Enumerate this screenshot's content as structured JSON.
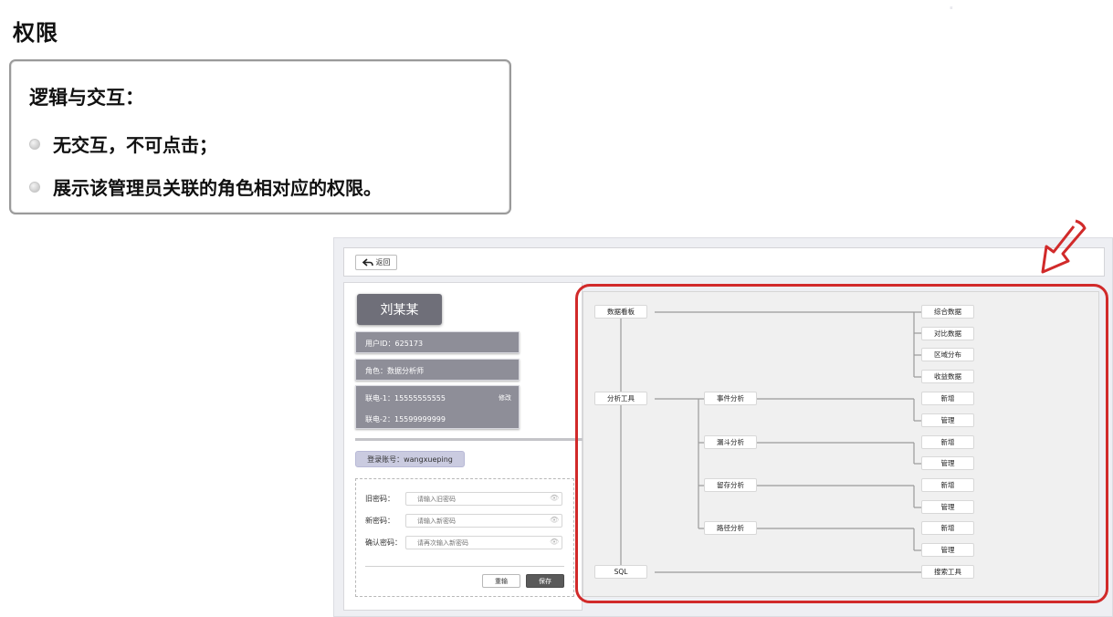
{
  "slide": {
    "title": "权限",
    "watermark": "   ·     ",
    "logic": {
      "heading": "逻辑与交互：",
      "bullets": [
        "无交互，不可点击；",
        "展示该管理员关联的角色相对应的权限。"
      ]
    }
  },
  "mockup": {
    "back_label": "返回",
    "user_name": "刘某某",
    "user_id": "用户ID：625173",
    "role": "角色：数据分析师",
    "phone1": "联电-1：15555555555",
    "phone2": "联电-2：15599999999",
    "edit_label": "修改",
    "account": "登录账号：wangxueping",
    "password_form": {
      "old_label": "旧密码：",
      "old_placeholder": "请输入旧密码",
      "new_label": "新密码：",
      "new_placeholder": "请输入新密码",
      "confirm_label": "确认密码：",
      "confirm_placeholder": "请再次输入新密码",
      "reset_label": "重输",
      "save_label": "保存"
    },
    "tree": {
      "root_items": [
        "数据看板",
        "分析工具",
        "SQL"
      ],
      "dashboard_children": [
        "综合数据",
        "对比数据",
        "区域分布",
        "收益数据"
      ],
      "analysis_children": [
        "事件分析",
        "漏斗分析",
        "留存分析",
        "路径分析"
      ],
      "leaf_actions": [
        "新增",
        "管理"
      ],
      "sql_child": "搜索工具"
    },
    "colors": {
      "highlight_outline": "#d12a2a",
      "name_button": "#6f6f79",
      "info_bar": "#8e8e98",
      "account_pill": "#cacbe0"
    }
  }
}
